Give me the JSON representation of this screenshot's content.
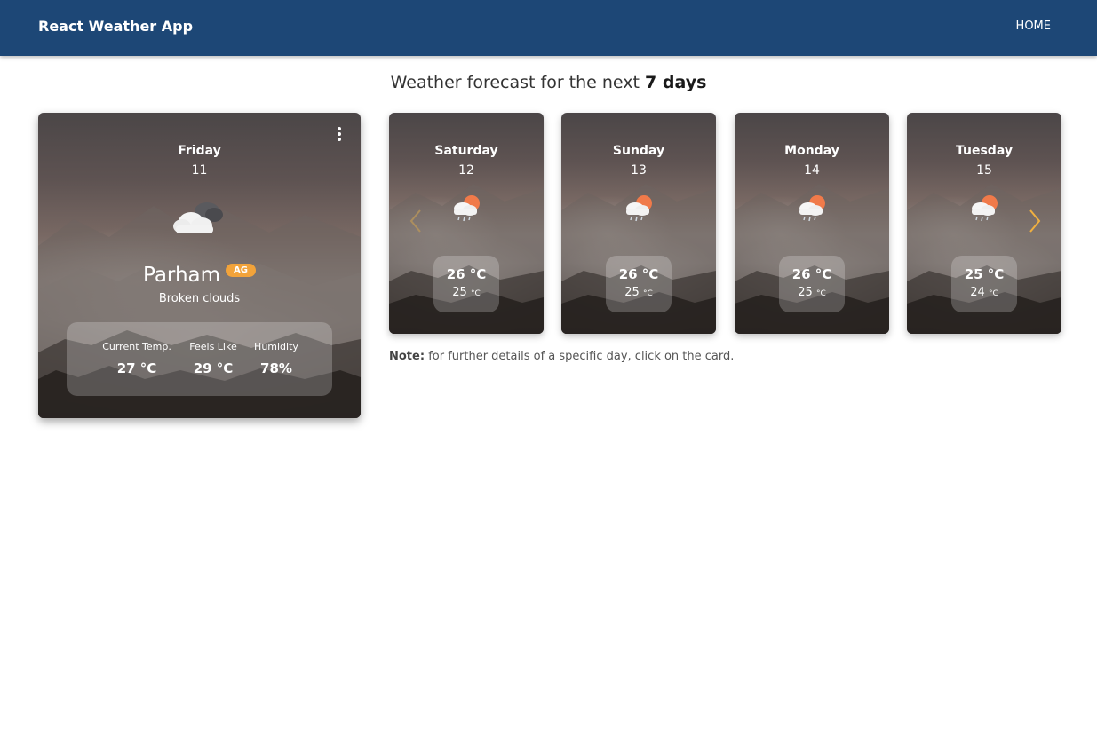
{
  "app": {
    "title": "React Weather App"
  },
  "nav": {
    "home": "HOME"
  },
  "heading": {
    "prefix": "Weather forecast for the next",
    "emphasis": "7 days"
  },
  "current": {
    "day": "Friday",
    "date": "11",
    "icon": "broken-clouds-icon",
    "city": "Parham",
    "country": "AG",
    "description": "Broken clouds",
    "stats": [
      {
        "label": "Current Temp.",
        "value": "27 °C"
      },
      {
        "label": "Feels Like",
        "value": "29 °C"
      },
      {
        "label": "Humidity",
        "value": "78%"
      }
    ]
  },
  "forecast": [
    {
      "day": "Saturday",
      "date": "12",
      "icon": "rain-sun-icon",
      "high": "26 °C",
      "low": "25",
      "low_unit": "°C"
    },
    {
      "day": "Sunday",
      "date": "13",
      "icon": "rain-sun-icon",
      "high": "26 °C",
      "low": "25",
      "low_unit": "°C"
    },
    {
      "day": "Monday",
      "date": "14",
      "icon": "rain-sun-icon",
      "high": "26 °C",
      "low": "25",
      "low_unit": "°C"
    },
    {
      "day": "Tuesday",
      "date": "15",
      "icon": "rain-sun-icon",
      "high": "25 °C",
      "low": "24",
      "low_unit": "°C"
    }
  ],
  "note": {
    "label": "Note:",
    "text": "for further details of a specific day, click on the card."
  },
  "colors": {
    "navbar": "#1d4776",
    "badge": "#f2a33a",
    "arrow": "#f0b040"
  }
}
